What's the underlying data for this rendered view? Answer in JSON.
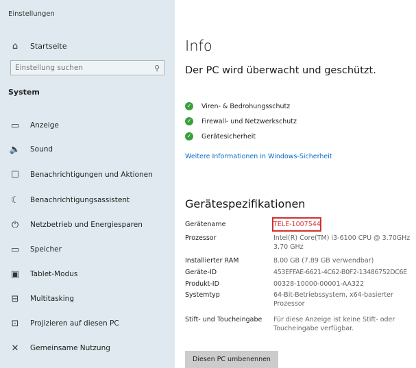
{
  "app_title": "Einstellungen",
  "sidebar": {
    "home_label": "Startseite",
    "home_icon": "home-icon",
    "search_placeholder": "Einstellung suchen",
    "section_title": "System",
    "items": [
      {
        "label": "Anzeige",
        "icon": "display-icon"
      },
      {
        "label": "Sound",
        "icon": "sound-icon"
      },
      {
        "label": "Benachrichtigungen und Aktionen",
        "icon": "notifications-icon"
      },
      {
        "label": "Benachrichtigungsassistent",
        "icon": "focus-assist-icon"
      },
      {
        "label": "Netzbetrieb und Energiesparen",
        "icon": "power-icon"
      },
      {
        "label": "Speicher",
        "icon": "storage-icon"
      },
      {
        "label": "Tablet-Modus",
        "icon": "tablet-icon"
      },
      {
        "label": "Multitasking",
        "icon": "multitasking-icon"
      },
      {
        "label": "Projizieren auf diesen PC",
        "icon": "projecting-icon"
      },
      {
        "label": "Gemeinsame Nutzung",
        "icon": "shared-experiences-icon"
      }
    ]
  },
  "main": {
    "title": "Info",
    "status_heading": "Der PC wird überwacht und geschützt.",
    "protections": [
      {
        "label": "Viren- & Bedrohungsschutz",
        "status_color": "#3c9f3f"
      },
      {
        "label": "Firewall- und Netzwerkschutz",
        "status_color": "#3c9f3f"
      },
      {
        "label": "Gerätesicherheit",
        "status_color": "#3c9f3f"
      }
    ],
    "security_link": "Weitere Informationen in Windows-Sicherheit",
    "specs_title": "Gerätespezifikationen",
    "specs": [
      {
        "label": "Gerätename",
        "value": "TELE-1007544",
        "highlight_color": "#d32f2f"
      },
      {
        "label": "Prozessor",
        "value": "Intel(R) Core(TM) i3-6100 CPU @ 3.70GHz 3.70 GHz"
      },
      {
        "label": "Installierter RAM",
        "value": "8.00 GB (7.89 GB verwendbar)"
      },
      {
        "label": "Geräte-ID",
        "value": "453EFFAE-6621-4C62-B0F2-13486752DC6E"
      },
      {
        "label": "Produkt-ID",
        "value": "00328-10000-00001-AA322"
      },
      {
        "label": "Systemtyp",
        "value": "64-Bit-Betriebssystem, x64-basierter Prozessor"
      },
      {
        "label": "Stift- und Toucheingabe",
        "value": "Für diese Anzeige ist keine Stift- oder Toucheingabe verfügbar."
      }
    ],
    "rename_button": "Diesen PC umbenennen"
  },
  "colors": {
    "sidebar_bg": "#dfe9ef",
    "accent_link": "#0a6dc2",
    "check_green": "#3c9f3f",
    "highlight_red": "#d32f2f"
  }
}
